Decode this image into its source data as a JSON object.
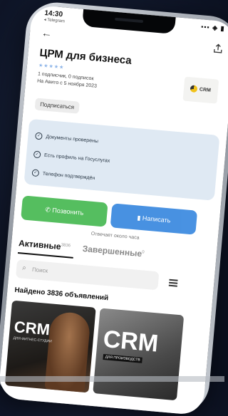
{
  "status_bar": {
    "time": "14:30",
    "carrier": "◂ Telegram",
    "indicators": "▪▪▪ ◈ ▮"
  },
  "header": {
    "back_icon": "←",
    "share_icon": "share-icon"
  },
  "profile": {
    "title": "ЦРМ для бизнеса",
    "rating_stars": "★★★★★",
    "subscribers": "1 подписчик, 0 подписок",
    "since": "На Авито с 5 ноября 2023",
    "subscribe_label": "Подписаться",
    "logo_text": "CRM"
  },
  "checks": [
    "Документы проверены",
    "Есть профиль на Госуслугах",
    "Телефон подтверждён"
  ],
  "actions": {
    "call_label": "Позвонить",
    "message_label": "Написать",
    "reply_note": "Отвечает около часа"
  },
  "tabs": [
    {
      "label": "Активные",
      "count": "3836"
    },
    {
      "label": "Завершенные",
      "count": "0"
    }
  ],
  "search": {
    "placeholder": "Поиск"
  },
  "results": {
    "found_text": "Найдено 3836 объявлений"
  },
  "listings": [
    {
      "big": "CRM",
      "small": "ДЛЯ ФИТНЕС-СТУДИИ"
    },
    {
      "big": "CRM",
      "small": "ДЛЯ ПРОИЗВОДСТВ"
    }
  ],
  "colors": {
    "call": "#4cbb57",
    "message": "#3f8ce0",
    "verified_bg": "#dfe9f3"
  }
}
